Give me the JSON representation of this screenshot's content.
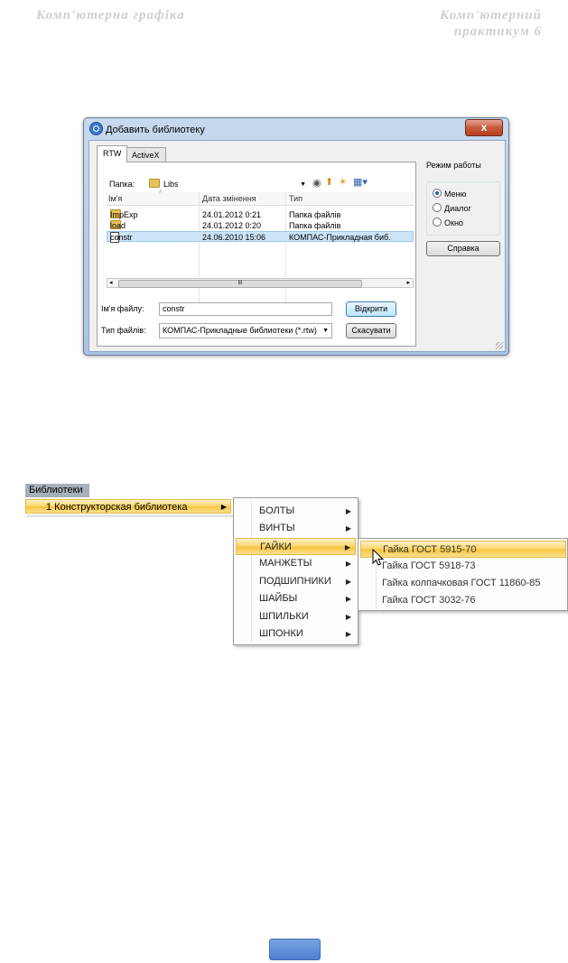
{
  "page_header": {
    "left": "Комп'ютерна графіка",
    "right_line1": "Комп'ютерний",
    "right_line2": "практикум 6"
  },
  "dialog": {
    "title": "Добавить библиотеку",
    "close_label": "x",
    "tabs": [
      "RTW",
      "ActiveX"
    ],
    "folder_label": "Папка:",
    "folder_value": "Libs",
    "columns": [
      "Ім'я",
      "Дата змінення",
      "Тип"
    ],
    "files": [
      {
        "name": "ImpExp",
        "date": "24.01.2012 0:21",
        "type": "Папка файлів",
        "icon": "folder-icon"
      },
      {
        "name": "load",
        "date": "24.01.2012 0:20",
        "type": "Папка файлів",
        "icon": "folder-icon"
      },
      {
        "name": "constr",
        "date": "24.06.2010 15:06",
        "type": "КОМПАС-Прикладная биб.",
        "icon": "library-file-icon",
        "selected": true
      }
    ],
    "scroll_thumb": "III",
    "filename_label": "Ім'я файлу:",
    "filename_value": "constr",
    "filetype_label": "Тип файлів:",
    "filetype_value": "КОМПАС-Прикладные библиотеки (*.rtw)",
    "open_button": "Відкрити",
    "cancel_button": "Скасувати",
    "mode_title": "Режим работы",
    "modes": [
      {
        "label": "Меню",
        "checked": true
      },
      {
        "label": "Диалог",
        "checked": false
      },
      {
        "label": "Окно",
        "checked": false
      }
    ],
    "help_button": "Справка"
  },
  "menus": {
    "menubar_label": "Библиотеки",
    "level1_item": "1 Конструкторская библиотека",
    "level2_items": [
      "БОЛТЫ",
      "ВИНТЫ",
      "ГАЙКИ",
      "МАНЖЕТЫ",
      "ПОДШИПНИКИ",
      "ШАЙБЫ",
      "ШПИЛЬКИ",
      "ШПОНКИ"
    ],
    "level2_selected": "ГАЙКИ",
    "level3_items": [
      "Гайка ГОСТ 5915-70",
      "Гайка ГОСТ 5918-73",
      "Гайка колпачковая ГОСТ 11860-85",
      "Гайка ГОСТ 3032-76"
    ],
    "level3_selected": "Гайка ГОСТ 5915-70"
  },
  "colors": {
    "menu_highlight": "#f6c540",
    "selection": "#cce4f7",
    "page_button": "#4d7fcf"
  }
}
